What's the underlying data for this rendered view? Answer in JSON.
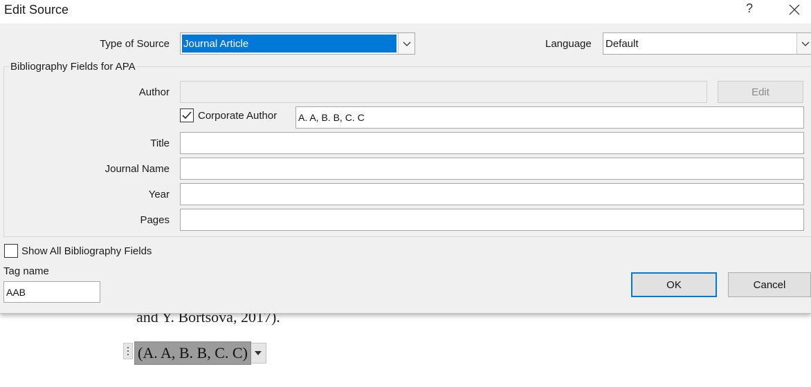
{
  "dialog": {
    "title": "Edit Source",
    "help_label": "?",
    "type_of_source": {
      "label": "Type of Source",
      "value": "Journal Article"
    },
    "language": {
      "label": "Language",
      "value": "Default"
    },
    "group_title": "Bibliography Fields for APA",
    "author": {
      "label": "Author",
      "value": "",
      "edit_button": "Edit"
    },
    "corporate_author": {
      "label": "Corporate Author",
      "checked": true,
      "value": "A. A, B. B, C. C"
    },
    "title_field": {
      "label": "Title",
      "value": ""
    },
    "journal_name": {
      "label": "Journal Name",
      "value": ""
    },
    "year": {
      "label": "Year",
      "value": ""
    },
    "pages": {
      "label": "Pages",
      "value": ""
    },
    "show_all": {
      "label": "Show All Bibliography Fields",
      "checked": false
    },
    "tag_name": {
      "label": "Tag name",
      "value": "AAB"
    },
    "ok_button": "OK",
    "cancel_button": "Cancel"
  },
  "document": {
    "text_line": "and Y. Bortsova, 2017).",
    "citation": "(A. A, B. B, C. C)"
  }
}
